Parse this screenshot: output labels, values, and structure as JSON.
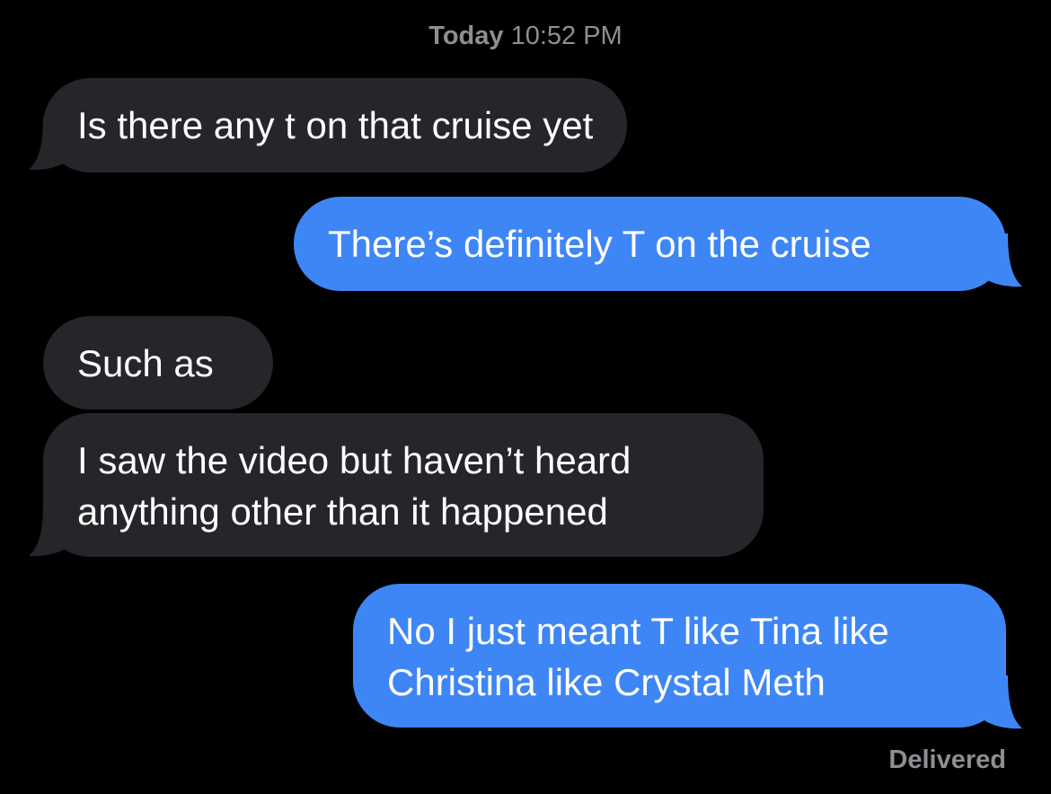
{
  "header": {
    "timestamp_day": "Today",
    "timestamp_time": "10:52 PM"
  },
  "colors": {
    "background": "#000000",
    "incoming_bubble": "#26252a",
    "outgoing_bubble": "#3e86f5",
    "meta_text": "#8e8e93"
  },
  "messages": [
    {
      "direction": "incoming",
      "lines": [
        "Is there any t on that cruise yet"
      ]
    },
    {
      "direction": "outgoing",
      "lines": [
        "There’s definitely T on the cruise"
      ]
    },
    {
      "direction": "incoming",
      "lines": [
        "Such as"
      ]
    },
    {
      "direction": "incoming",
      "lines": [
        "I saw the video but haven’t heard",
        "anything other than it happened"
      ]
    },
    {
      "direction": "outgoing",
      "lines": [
        "No I just meant T like Tina like",
        "Christina like Crystal Meth"
      ]
    }
  ],
  "status": {
    "label": "Delivered"
  }
}
